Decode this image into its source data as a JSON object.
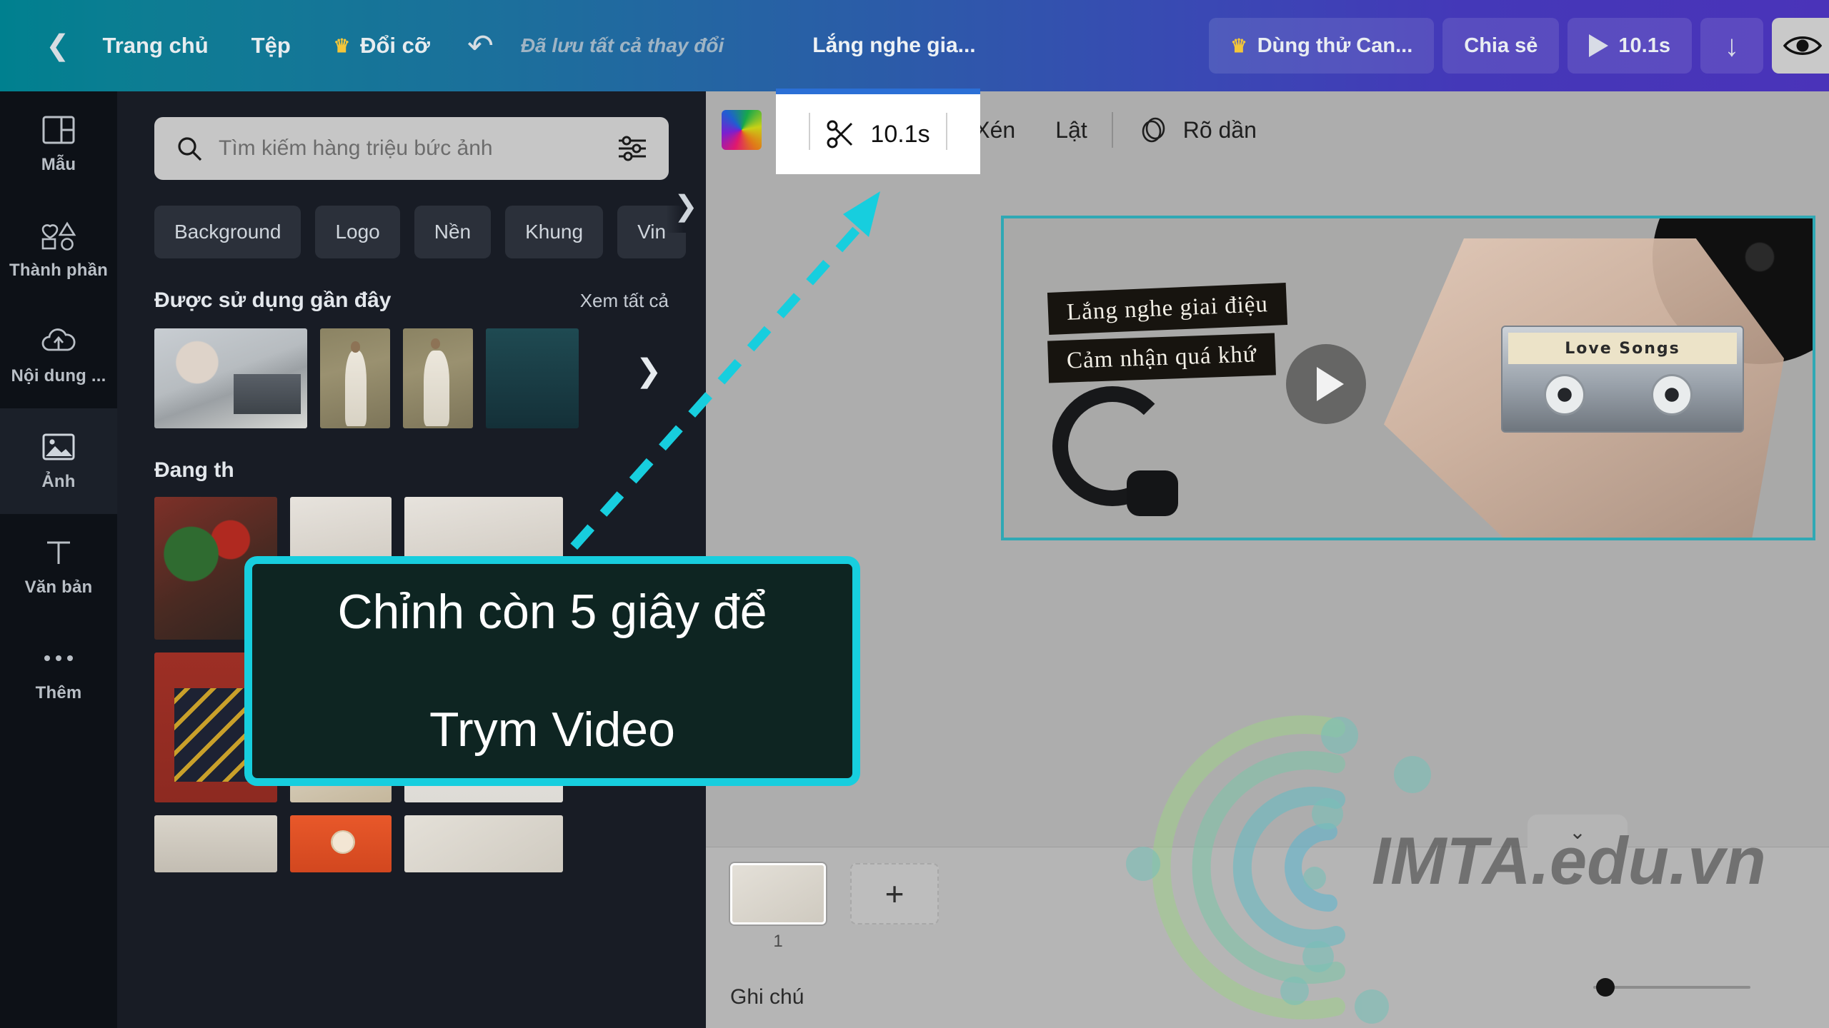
{
  "topbar": {
    "back_icon": "chevron-left-icon",
    "home_label": "Trang chủ",
    "file_label": "Tệp",
    "resize_label": "Đổi cỡ",
    "resize_crown": "♛",
    "undo_icon": "↺",
    "saved_status": "Đã lưu tất cả thay đổi",
    "doc_title": "Lắng nghe gia...",
    "try_canva_label": "Dùng thử Can...",
    "try_canva_crown": "♛",
    "share_label": "Chia sẻ",
    "duration_label": "10.1s",
    "download_icon": "download-icon",
    "preview_icon": "eye-icon"
  },
  "sidebar": {
    "items": [
      {
        "label": "Mẫu",
        "icon": "template-icon",
        "active": false
      },
      {
        "label": "Thành phần",
        "icon": "shapes-icon",
        "active": false
      },
      {
        "label": "Nội dung ...",
        "icon": "upload-cloud-icon",
        "active": false
      },
      {
        "label": "Ảnh",
        "icon": "image-icon",
        "active": true
      },
      {
        "label": "Văn bản",
        "icon": "text-icon",
        "active": false
      },
      {
        "label": "Thêm",
        "icon": "more-dots-icon",
        "active": false
      }
    ]
  },
  "panel": {
    "search": {
      "placeholder": "Tìm kiếm hàng triệu bức ảnh",
      "search_icon": "search-icon",
      "filter_icon": "filter-sliders-icon"
    },
    "chips": [
      "Background",
      "Logo",
      "Nền",
      "Khung",
      "Vin"
    ],
    "chips_next_icon": "chevron-right-icon",
    "recent": {
      "title": "Được sử dụng gần đây",
      "see_all": "Xem tất cả",
      "next_icon": "chevron-right-icon"
    },
    "trending": {
      "title": "Đang th"
    }
  },
  "editor": {
    "toolbar": {
      "color_swatch": "color-swatch",
      "trim_icon": "scissors-icon",
      "trim_value": "10.1s",
      "crop_label": "Xén",
      "flip_label": "Lật",
      "fade_icon": "fade-icon",
      "fade_label": "Rõ dần"
    },
    "canvas": {
      "caption_1": "Lắng nghe giai điệu",
      "caption_2": "Cảm nhận quá khứ",
      "cassette_label": "Love Songs",
      "play_icon": "play-icon"
    },
    "timeline": {
      "page_number": "1",
      "add_page_icon": "plus-icon",
      "notes_label": "Ghi chú",
      "collapse_icon": "chevron-down-icon",
      "zoom_value": "10"
    }
  },
  "callout": {
    "line_1": "Chỉnh còn 5 giây để",
    "line_2": "Trym Video",
    "border_color": "#17cede",
    "fill_color": "#0e2522"
  },
  "watermark": {
    "text": "IMTA.edu.vn"
  }
}
